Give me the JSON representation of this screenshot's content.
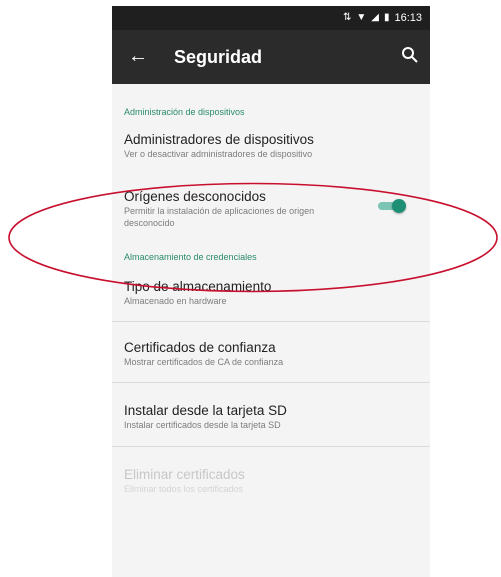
{
  "status_bar": {
    "time": "16:13"
  },
  "app_bar": {
    "title": "Seguridad"
  },
  "sections": [
    {
      "header": "Administración de dispositivos"
    },
    {
      "header": "Almacenamiento de credenciales"
    }
  ],
  "items": {
    "device_admins": {
      "title": "Administradores de dispositivos",
      "subtitle": "Ver o desactivar administradores de dispositivo"
    },
    "unknown_sources": {
      "title": "Orígenes desconocidos",
      "subtitle": "Permitir la instalación de aplicaciones de origen desconocido",
      "enabled": true
    },
    "storage_type": {
      "title": "Tipo de almacenamiento",
      "subtitle": "Almacenado en hardware"
    },
    "trusted_certs": {
      "title": "Certificados de confianza",
      "subtitle": "Mostrar certificados de CA de confianza"
    },
    "install_sd": {
      "title": "Instalar desde la tarjeta SD",
      "subtitle": "Instalar certificados desde la tarjeta SD"
    },
    "remove_certs": {
      "title": "Eliminar certificados",
      "subtitle": "Eliminar todos los certificados"
    }
  },
  "colors": {
    "accent": "#1e8f75",
    "annotation": "#c8102e"
  }
}
